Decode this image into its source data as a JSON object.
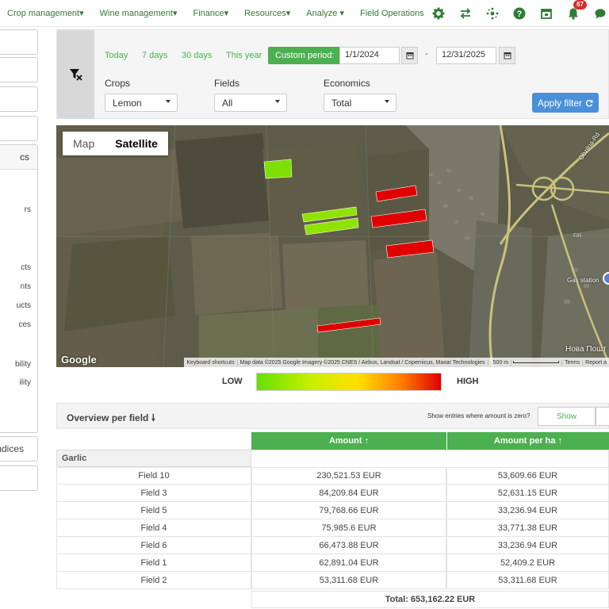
{
  "nav": {
    "menu": [
      "Crop management",
      "Wine management",
      "Finance",
      "Resources",
      "Analyze",
      "Field Operations"
    ],
    "notification_count": "67"
  },
  "sidebar": {
    "panel_heading_fragment": "cs",
    "fragments": [
      "rs",
      "cts",
      "nts",
      "ucts",
      "ces",
      "bility",
      "ility"
    ],
    "bottom_item_fragment": "ndices"
  },
  "filter": {
    "periods": [
      "Today",
      "7 days",
      "30 days",
      "This year"
    ],
    "custom_label": "Custom period:",
    "date_from": "1/1/2024",
    "date_separator": "-",
    "date_to": "12/31/2025",
    "crops_label": "Crops",
    "crops_value": "Lemon",
    "fields_label": "Fields",
    "fields_value": "All",
    "economics_label": "Economics",
    "economics_value": "Total",
    "apply_label": "Apply filter"
  },
  "map": {
    "tab_map": "Map",
    "tab_satellite": "Satellite",
    "google": "Google",
    "attribution": [
      "Keyboard shortcuts",
      "Map data ©2025 Google Imagery ©2025 CNES / Airbus, Landsat / Copernicus, Maxar Technologies",
      "500 m",
      "Terms",
      "Report a"
    ],
    "labels": [
      "Gas station",
      "Нова Пошт",
      "Obzilna-Rd",
      "E85"
    ]
  },
  "legend": {
    "low": "LOW",
    "high": "HIGH"
  },
  "overview": {
    "title": "Overview per field",
    "zero_question": "Show entries where amount is zero?",
    "show_label": "Show",
    "col_amount": "Amount ↑",
    "col_amount_per_ha": "Amount per ha ↑",
    "group": "Garlic",
    "rows": [
      {
        "field": "Field 10",
        "amount": "230,521.53 EUR",
        "per_ha": "53,609.66 EUR"
      },
      {
        "field": "Field 3",
        "amount": "84,209.84 EUR",
        "per_ha": "52,631.15 EUR"
      },
      {
        "field": "Field 5",
        "amount": "79,768.66 EUR",
        "per_ha": "33,236.94 EUR"
      },
      {
        "field": "Field 4",
        "amount": "75,985.6 EUR",
        "per_ha": "33,771.38 EUR"
      },
      {
        "field": "Field 6",
        "amount": "66,473.88 EUR",
        "per_ha": "33,236.94 EUR"
      },
      {
        "field": "Field 1",
        "amount": "62,891.04 EUR",
        "per_ha": "52,409.2 EUR"
      },
      {
        "field": "Field 2",
        "amount": "53,311.68 EUR",
        "per_ha": "53,311.68 EUR"
      }
    ],
    "total": "Total: 653,162.22 EUR"
  },
  "colors": {
    "accent": "#4caf50",
    "apply": "#4a90d9",
    "field_high": "#e00000",
    "field_low": "#7ee000"
  }
}
